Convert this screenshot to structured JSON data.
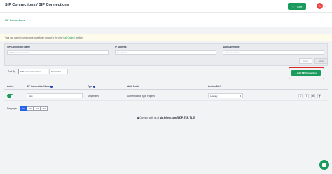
{
  "header": {
    "breadcrumb": "SIP Connections / SIP Connections",
    "cart_label": "Cart",
    "avatar_initial": "A"
  },
  "tabs": {
    "active": "SIP Connections"
  },
  "notice": {
    "text": "Your call control connections have been moved to the new",
    "link": "Call Control",
    "suffix": "section."
  },
  "filters": {
    "name_label": "SIP Connection Name",
    "name_placeholder": "SIP Connection Name",
    "ip_label": "IP Address",
    "ip_placeholder": "IP Address",
    "auth_label": "Auth Username",
    "auth_placeholder": "Auth Username",
    "clear_label": "Clear",
    "apply_label": "Apply"
  },
  "sort": {
    "label": "Sort By",
    "by_value": "SIP Connection Name",
    "order_value": "Sort Order"
  },
  "add_button_label": "Add SIP Connection",
  "table": {
    "headers": [
      "Active",
      "SIP Connection Name",
      "Type",
      "Auth Detail",
      "AnchorSite®"
    ],
    "rows": [
      {
        "active": true,
        "name": "Test",
        "type": "Unspecified",
        "auth_detail": "Authentication type required",
        "anchorsite": "Latency"
      }
    ]
  },
  "per_page": {
    "label": "Per page",
    "options": [
      "20",
      "50",
      "100",
      "250"
    ],
    "selected": "20"
  },
  "footer": {
    "prefix": "Connect with us at",
    "host": "sip.telnyx.com",
    "ports": "[UDP, TCP, TLS]"
  },
  "colors": {
    "accent": "#1a9b5c",
    "highlight_border": "#dc2626",
    "selected_page": "#2563eb"
  }
}
